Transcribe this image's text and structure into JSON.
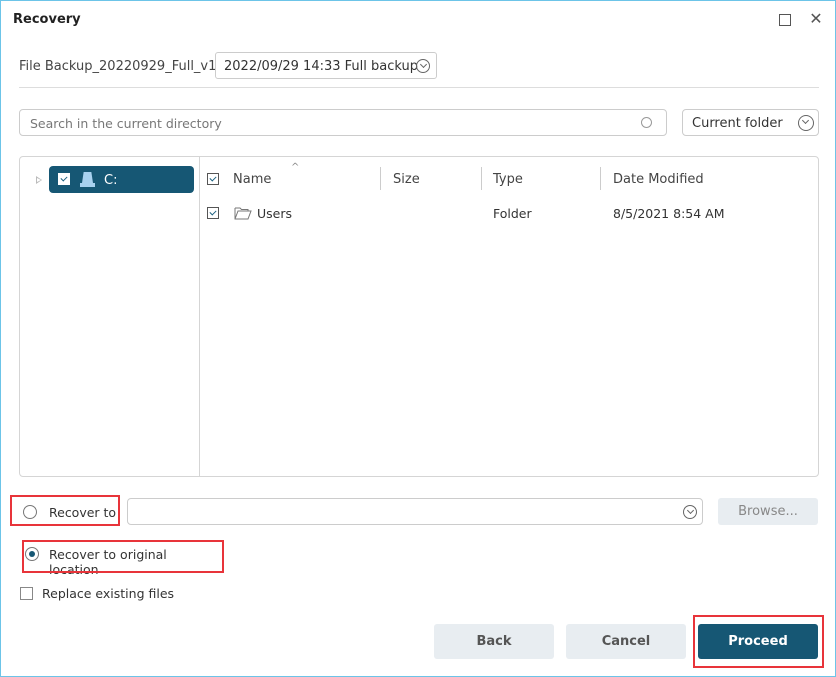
{
  "window": {
    "title": "Recovery",
    "controls": {
      "maximize": "maximize-icon",
      "close": "close-icon"
    }
  },
  "backup": {
    "name": "File Backup_20220929_Full_v1",
    "version_selected": "2022/09/29 14:33 Full backup"
  },
  "search": {
    "placeholder": "Search in the current directory",
    "value": "",
    "scope_selected": "Current folder"
  },
  "tree": {
    "items": [
      {
        "label": "C:",
        "icon": "drive-icon",
        "checked": true,
        "selected": true,
        "expanded": false
      }
    ]
  },
  "file_list": {
    "columns": [
      "Name",
      "Size",
      "Type",
      "Date Modified"
    ],
    "sort_column": "Name",
    "header_checked": true,
    "rows": [
      {
        "checked": true,
        "icon": "folder-icon",
        "name": "Users",
        "size": "",
        "type": "Folder",
        "date_modified": "8/5/2021 8:54 AM"
      }
    ]
  },
  "destination": {
    "recover_to_label": "Recover to",
    "recover_to_selected": false,
    "path_value": "",
    "browse_label": "Browse...",
    "original_location_label": "Recover to original location",
    "original_location_selected": true,
    "replace_label": "Replace existing files",
    "replace_checked": false
  },
  "footer": {
    "back_label": "Back",
    "cancel_label": "Cancel",
    "proceed_label": "Proceed"
  },
  "colors": {
    "accent": "#165774",
    "window_border": "#6cc4e8",
    "highlight_annotation": "#e8343a",
    "secondary_button": "#e8edf1"
  }
}
